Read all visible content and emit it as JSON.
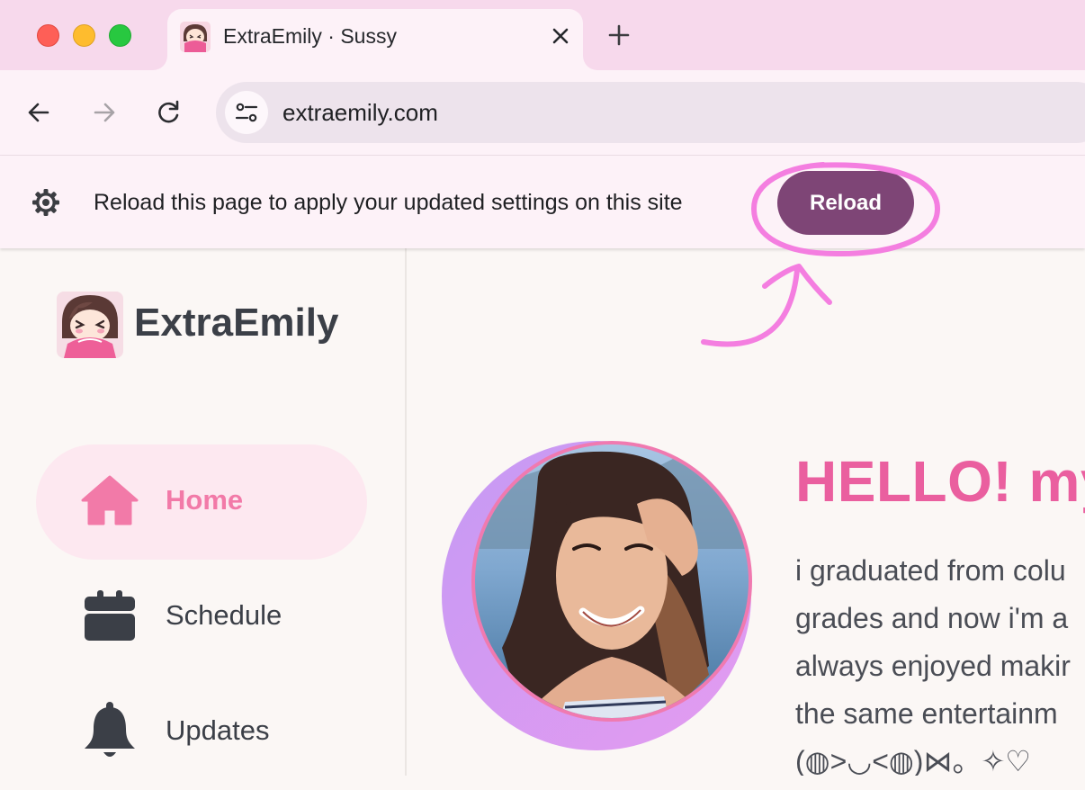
{
  "browser": {
    "tab": {
      "title": "ExtraEmily · Sussy",
      "favicon": "extraemily-emote-icon"
    },
    "address_bar": {
      "url": "extraemily.com"
    },
    "icons": [
      "back-arrow-icon",
      "forward-arrow-icon",
      "reload-icon",
      "site-settings-icon",
      "close-icon",
      "plus-icon"
    ]
  },
  "infobar": {
    "message": "Reload this page to apply your updated settings on this site",
    "reload_label": "Reload",
    "annotation_color": "#f47ee0"
  },
  "site": {
    "brand": "ExtraEmily",
    "nav": [
      {
        "label": "Home",
        "icon": "home-icon",
        "active": true
      },
      {
        "label": "Schedule",
        "icon": "calendar-icon",
        "active": false
      },
      {
        "label": "Updates",
        "icon": "bell-icon",
        "active": false
      }
    ],
    "hero": {
      "title": "HELLO! my",
      "bio_lines": [
        "i graduated from colu",
        "grades and now i'm a",
        "always enjoyed makir",
        "the same entertainm",
        "(◍>◡<◍)⋈。✧♡"
      ]
    },
    "colors": {
      "accent_pink": "#f27aa8",
      "title_pink": "#ea5f9f",
      "button_purple": "#7e4576",
      "tab_strip": "#f7d9ec"
    }
  }
}
